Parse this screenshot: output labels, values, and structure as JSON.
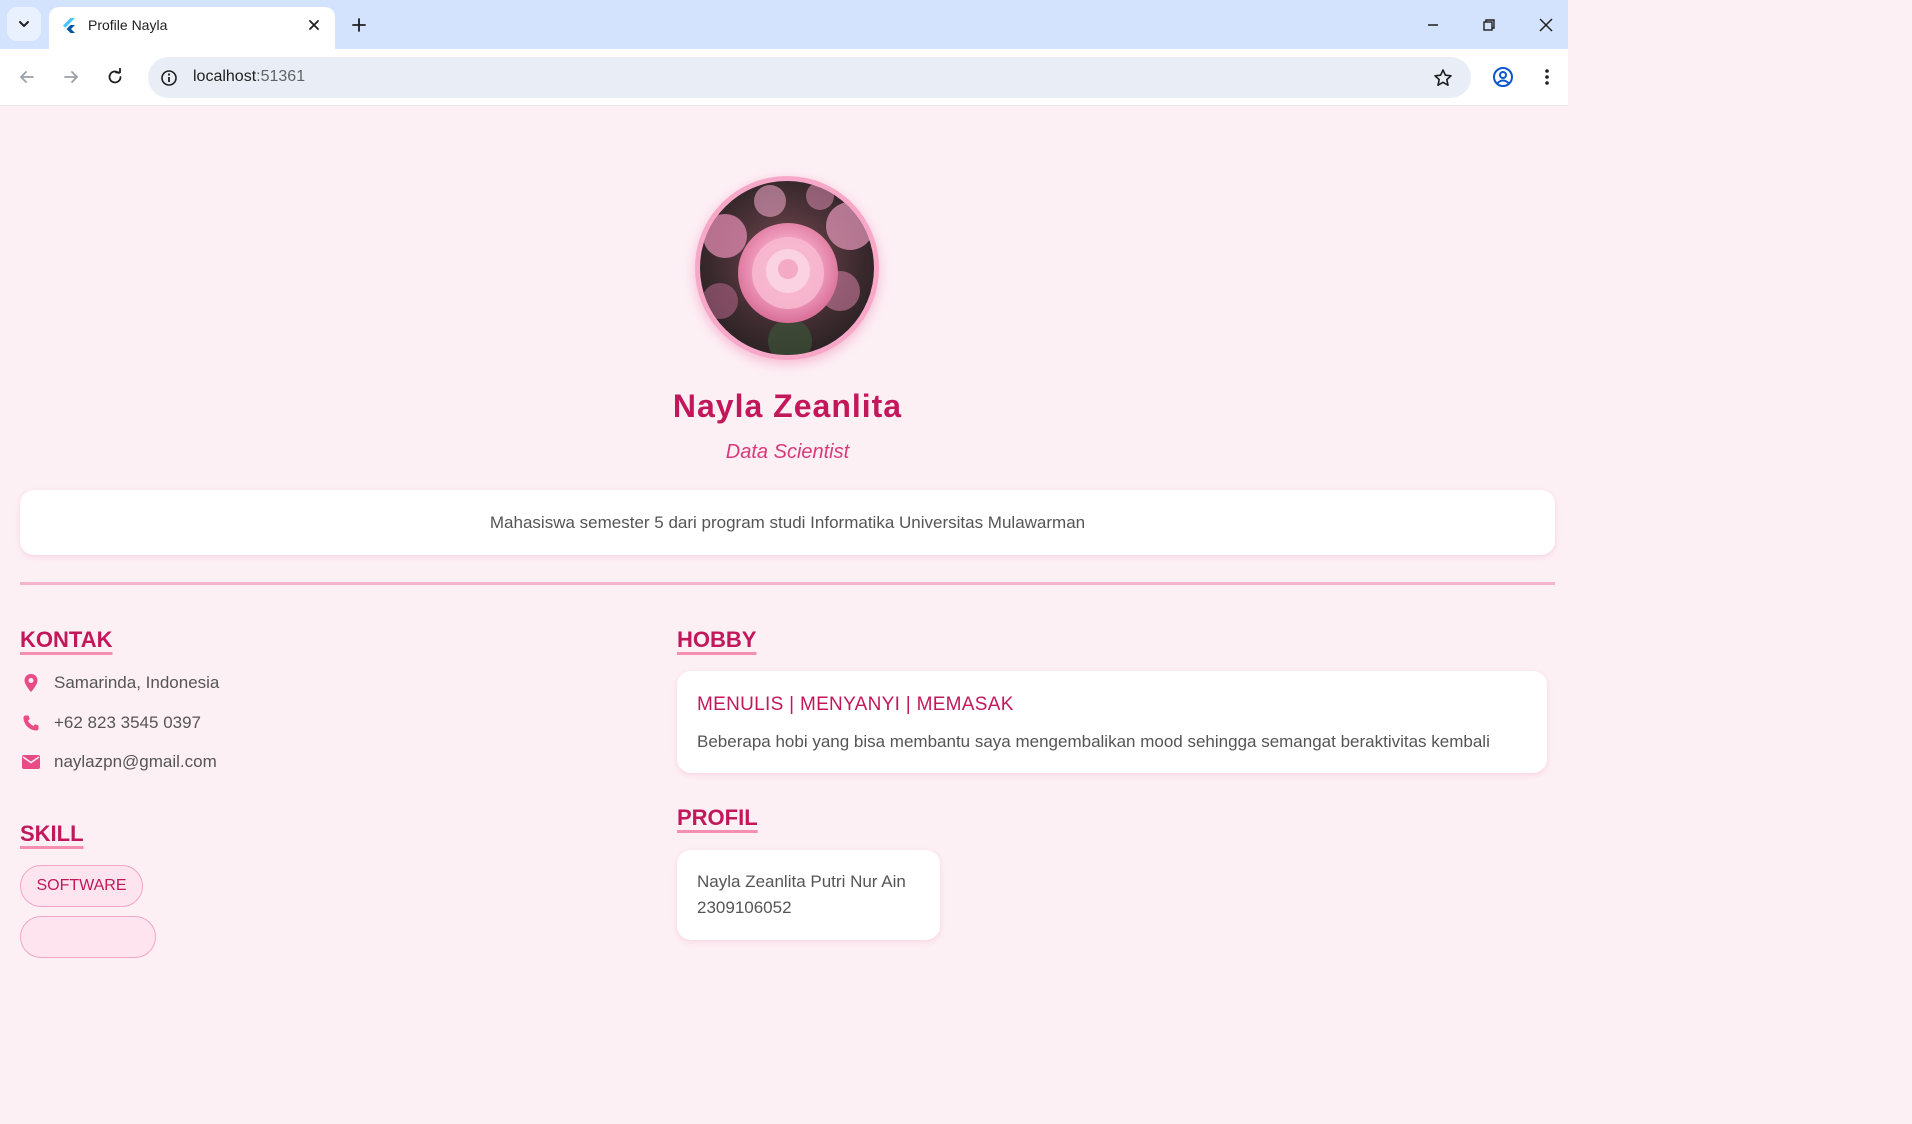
{
  "browser": {
    "tab_title": "Profile Nayla",
    "url_host": "localhost",
    "url_port": ":51361"
  },
  "profile": {
    "name": "Nayla Zeanlita",
    "role": "Data Scientist",
    "bio": "Mahasiswa semester 5 dari program studi Informatika Universitas Mulawarman"
  },
  "kontak": {
    "title": "KONTAK",
    "items": [
      {
        "icon": "location-pin-icon",
        "text": "Samarinda, Indonesia"
      },
      {
        "icon": "phone-icon",
        "text": "+62 823 3545 0397"
      },
      {
        "icon": "email-icon",
        "text": "naylazpn@gmail.com"
      }
    ]
  },
  "skill": {
    "title": "SKILL",
    "chips": [
      "SOFTWARE"
    ]
  },
  "hobby": {
    "title": "HOBBY",
    "card_title": "MENULIS | MENYANYI | MEMASAK",
    "card_desc": "Beberapa hobi yang bisa membantu saya mengembalikan mood sehingga semangat beraktivitas kembali"
  },
  "profil": {
    "title": "PROFIL",
    "lines": [
      "Nayla Zeanlita Putri Nur Ain",
      "2309106052"
    ]
  },
  "colors": {
    "accent": "#c2185b",
    "background": "#fdf0f5",
    "tabstrip": "#d3e3fd"
  }
}
